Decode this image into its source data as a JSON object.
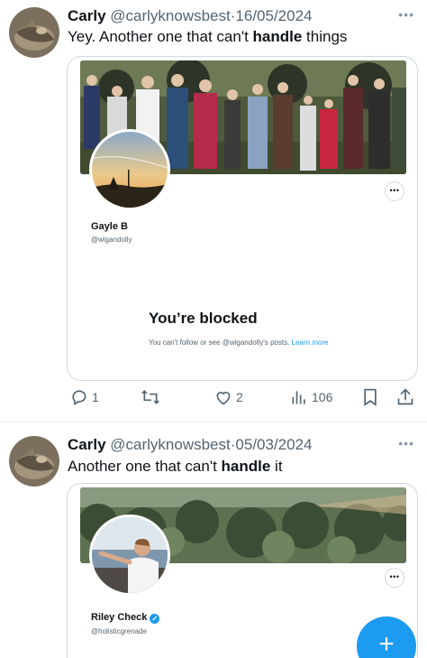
{
  "tweets": [
    {
      "name": "Carly",
      "handle": "@carlyknowsbest",
      "separator": "·",
      "date": "16/05/2024",
      "text_before": "Yey. Another one that can't ",
      "text_bold": "handle",
      "text_after": " things",
      "card": {
        "profile_name": "Gayle B",
        "profile_handle": "@wigandolly",
        "blocked_title": "You’re blocked",
        "blocked_desc": "You can't follow or see @wigandolly's posts.",
        "learn_more": "Learn more"
      },
      "actions": {
        "replies": "1",
        "likes": "2",
        "views": "106"
      }
    },
    {
      "name": "Carly",
      "handle": "@carlyknowsbest",
      "separator": "·",
      "date": "05/03/2024",
      "text_before": "Another one that can't ",
      "text_bold": "handle",
      "text_after": " it",
      "card": {
        "profile_name": "Riley Check",
        "profile_handle": "@holisticgrenade"
      }
    }
  ],
  "icons": [
    "more-icon",
    "reply-icon",
    "retweet-icon",
    "like-icon",
    "views-icon",
    "bookmark-icon",
    "share-icon",
    "verified-icon",
    "compose-plus-icon"
  ],
  "colors": {
    "accent": "#1d9bf0",
    "muted": "#536471",
    "border": "#cfd9de"
  }
}
